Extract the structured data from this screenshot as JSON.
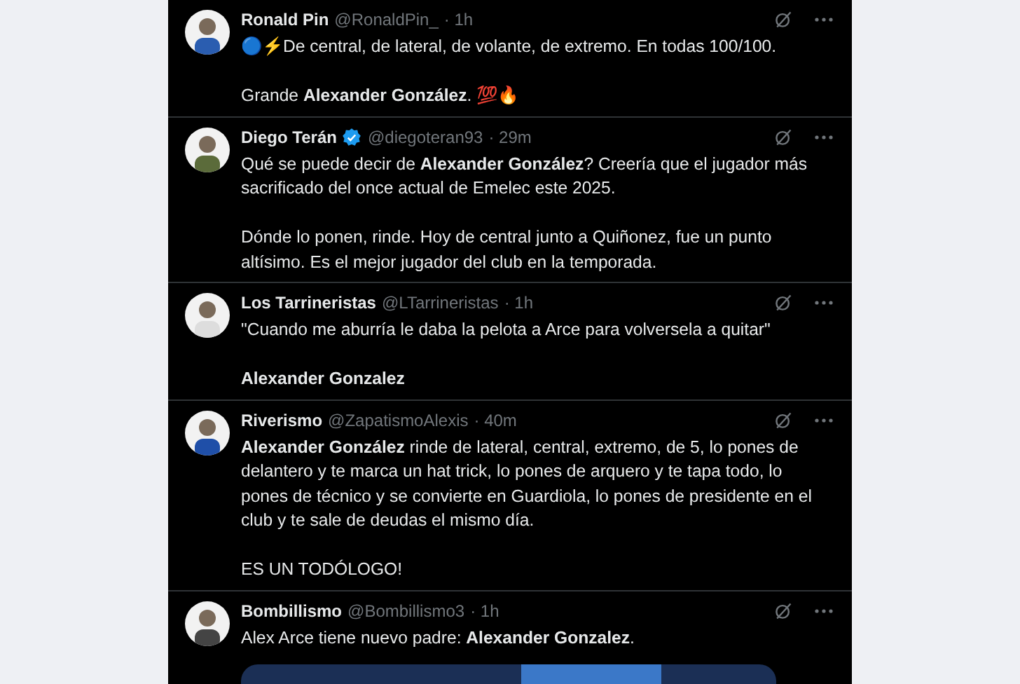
{
  "tweets": [
    {
      "name": "Ronald Pin",
      "verified": false,
      "handle": "@RonaldPin_",
      "time": "· 1h",
      "text": "🔵⚡De central, de lateral, de volante, de extremo. En todas 100/100.\n\nGrande **Alexander González**. 💯🔥"
    },
    {
      "name": "Diego Terán",
      "verified": true,
      "handle": "@diegoteran93",
      "time": "· 29m",
      "text": "Qué se puede decir de **Alexander González**? Creería que el jugador más sacrificado del once actual de Emelec este 2025.\n\nDónde lo ponen, rinde. Hoy de central junto a Quiñonez, fue un punto altísimo. Es el mejor jugador del club en la temporada."
    },
    {
      "name": "Los Tarrineristas",
      "verified": false,
      "handle": "@LTarrineristas",
      "time": "· 1h",
      "text": "\"Cuando me aburría le daba la pelota a Arce para volversela a quitar\"\n\n**Alexander Gonzalez**"
    },
    {
      "name": "Riverismo",
      "verified": false,
      "handle": "@ZapatismoAlexis",
      "time": "· 40m",
      "text": "**Alexander González** rinde de lateral, central, extremo, de 5, lo pones de delantero y te marca un hat trick, lo pones de arquero y te tapa todo, lo pones de técnico y se convierte en Guardiola, lo pones de presidente en el club y te sale de deudas el mismo día.\n\nES UN TODÓLOGO!"
    },
    {
      "name": "Bombillismo",
      "verified": false,
      "handle": "@Bombillismo3",
      "time": "· 1h",
      "text": "Alex Arce tiene nuevo padre: **Alexander Gonzalez**."
    }
  ]
}
